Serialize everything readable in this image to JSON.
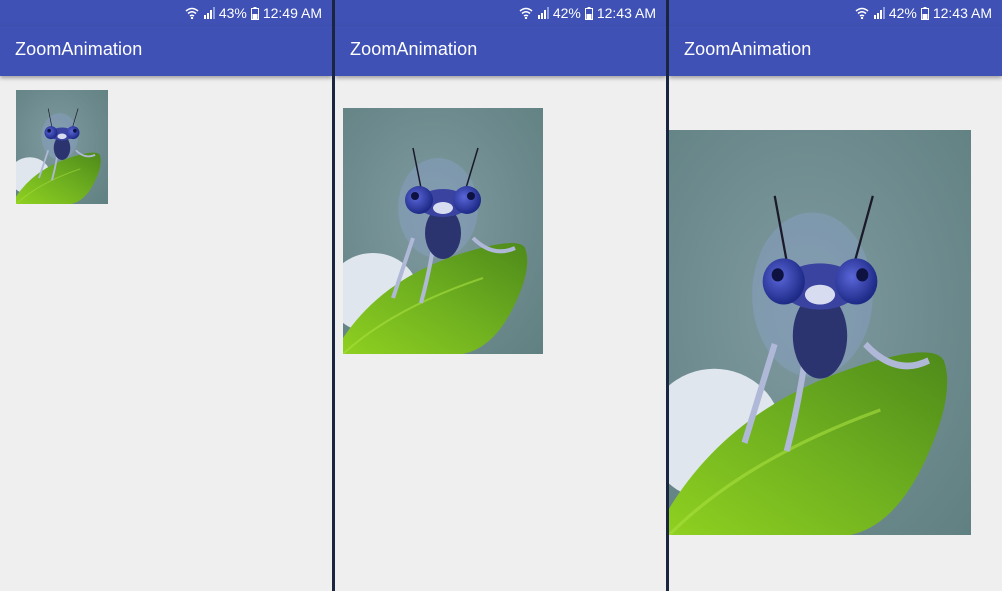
{
  "screens": [
    {
      "status": {
        "battery_percent": "43%",
        "time": "12:49 AM"
      },
      "app_title": "ZoomAnimation"
    },
    {
      "status": {
        "battery_percent": "42%",
        "time": "12:43 AM"
      },
      "app_title": "ZoomAnimation"
    },
    {
      "status": {
        "battery_percent": "42%",
        "time": "12:43 AM"
      },
      "app_title": "ZoomAnimation"
    }
  ],
  "colors": {
    "app_bar": "#3f51b5",
    "background": "#efefef",
    "divider": "#1a2540"
  },
  "icons": [
    "wifi-icon",
    "signal-icon",
    "battery-icon"
  ],
  "image_subject": "damselfly-on-leaf-photo"
}
